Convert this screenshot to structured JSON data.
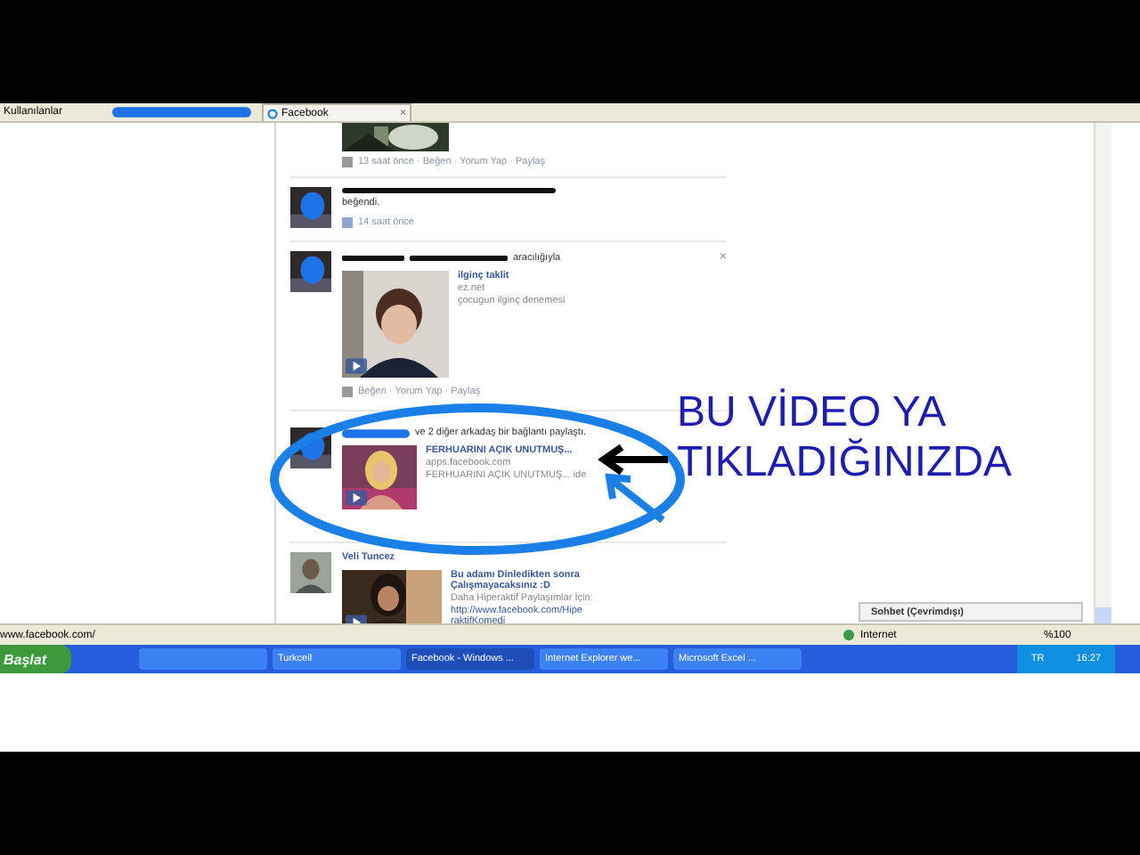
{
  "browser": {
    "favorites_label": "Kullanılanlar",
    "tab": {
      "label": "Facebook",
      "close": "×"
    }
  },
  "feed": [
    {
      "kind": "video_tail",
      "meta": "13 saat önce · Beğen · Yorum Yap · Paylaş"
    },
    {
      "kind": "like",
      "action": "beğendi.",
      "time": "14 saat önce"
    },
    {
      "kind": "share",
      "via": "aracılığıyla",
      "close": "×",
      "title": "ilginç taklit",
      "source": "ez.net",
      "description": "çocugun ilginç denemesi",
      "meta": "Beğen · Yorum Yap · Paylaş"
    },
    {
      "kind": "link",
      "via": "ve 2 diğer arkadaş bir bağlantı paylaştı.",
      "title": "FERHUARINI AÇIK UNUTMUŞ...",
      "source": "apps.facebook.com",
      "description": "FERHUARINI AÇIK UNUTMUŞ... ide"
    },
    {
      "kind": "post",
      "author": "Veli Tuncez",
      "title": "Bu adamı Dinledikten sonra Çalışmayacaksınız :D",
      "description": "Daha Hiperaktif Paylaşımlar İçin:",
      "link": "http://www.facebook.com/HiperaktifKomedi"
    }
  ],
  "chat": {
    "label": "Sohbet (Çevrimdışı)"
  },
  "status_bar": {
    "url": "www.facebook.com/",
    "zone": "Internet",
    "zoom": "%100"
  },
  "taskbar": {
    "start": "Başlat",
    "buttons": [
      "Turkcell",
      "Facebook - Windows ...",
      "Internet Explorer we...",
      "Microsoft Excel ..."
    ],
    "language": "TR",
    "clock": "16:27"
  },
  "annotation": {
    "lines": [
      "BU VİDEO YA",
      "TIKLADIĞINIZDA"
    ]
  }
}
